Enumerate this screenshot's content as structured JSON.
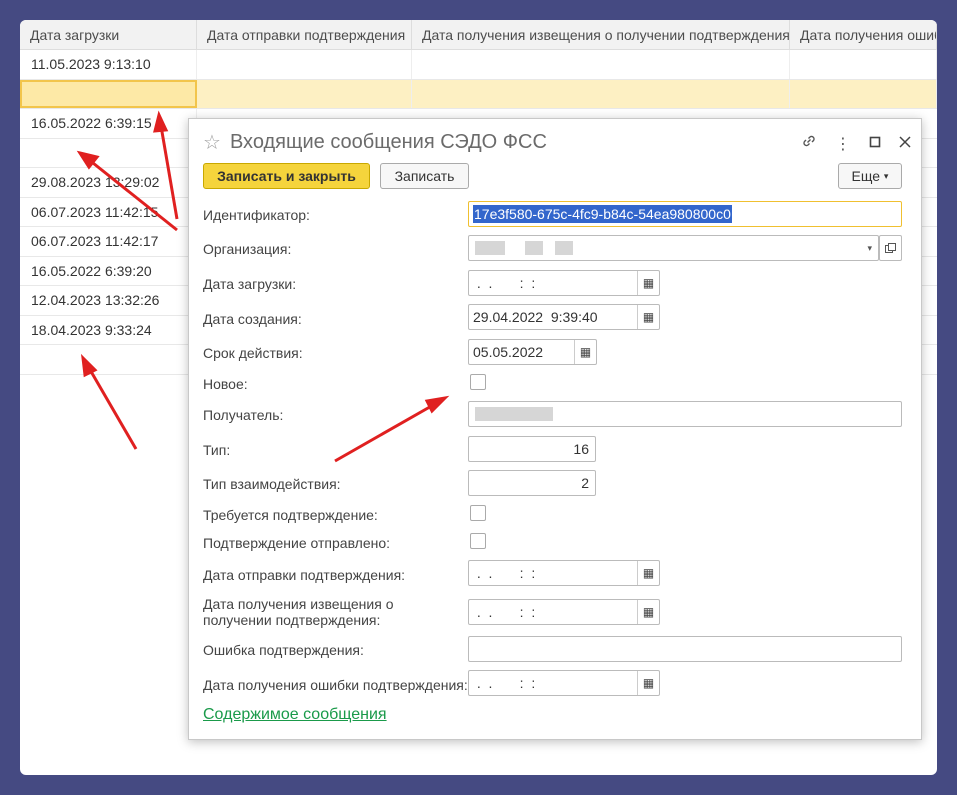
{
  "table": {
    "headers": [
      "Дата загрузки",
      "Дата отправки подтверждения",
      "Дата получения извещения о получении подтверждения",
      "Дата получения ошибки"
    ],
    "rows": [
      "11.05.2023 9:13:10",
      "",
      "16.05.2022 6:39:15",
      "",
      "29.08.2023 13:29:02",
      "06.07.2023 11:42:15",
      "06.07.2023 11:42:17",
      "16.05.2022 6:39:20",
      "12.04.2023 13:32:26",
      "18.04.2023 9:33:24",
      ""
    ]
  },
  "dialog": {
    "title": "Входящие сообщения СЭДО ФСС",
    "btn_save_close": "Записать и закрыть",
    "btn_save": "Записать",
    "btn_more": "Еще",
    "fields": {
      "id_label": "Идентификатор:",
      "id_value": "17e3f580-675c-4fc9-b84c-54ea980800c0",
      "org_label": "Организация:",
      "load_label": "Дата загрузки:",
      "load_value": " .  .       :  :",
      "created_label": "Дата создания:",
      "created_value": "29.04.2022  9:39:40",
      "valid_label": "Срок действия:",
      "valid_value": "05.05.2022",
      "new_label": "Новое:",
      "recipient_label": "Получатель:",
      "type_label": "Тип:",
      "type_value": "16",
      "interact_label": "Тип взаимодействия:",
      "interact_value": "2",
      "confirm_req_label": "Требуется подтверждение:",
      "confirm_sent_label": "Подтверждение отправлено:",
      "send_date_label": "Дата отправки подтверждения:",
      "send_date_value": " .  .       :  :",
      "notice_label_1": "Дата получения извещения о",
      "notice_label_2": "получении подтверждения:",
      "notice_value": " .  .       :  :",
      "error_label": "Ошибка подтверждения:",
      "error_date_label": "Дата получения ошибки подтверждения:",
      "error_date_value": " .  .       :  :"
    },
    "link": "Содержимое сообщения"
  },
  "colors": {
    "primary_button": "#f5d43c",
    "link": "#1a9a4a",
    "arrow": "#e02020",
    "selection": "#3366cc"
  }
}
